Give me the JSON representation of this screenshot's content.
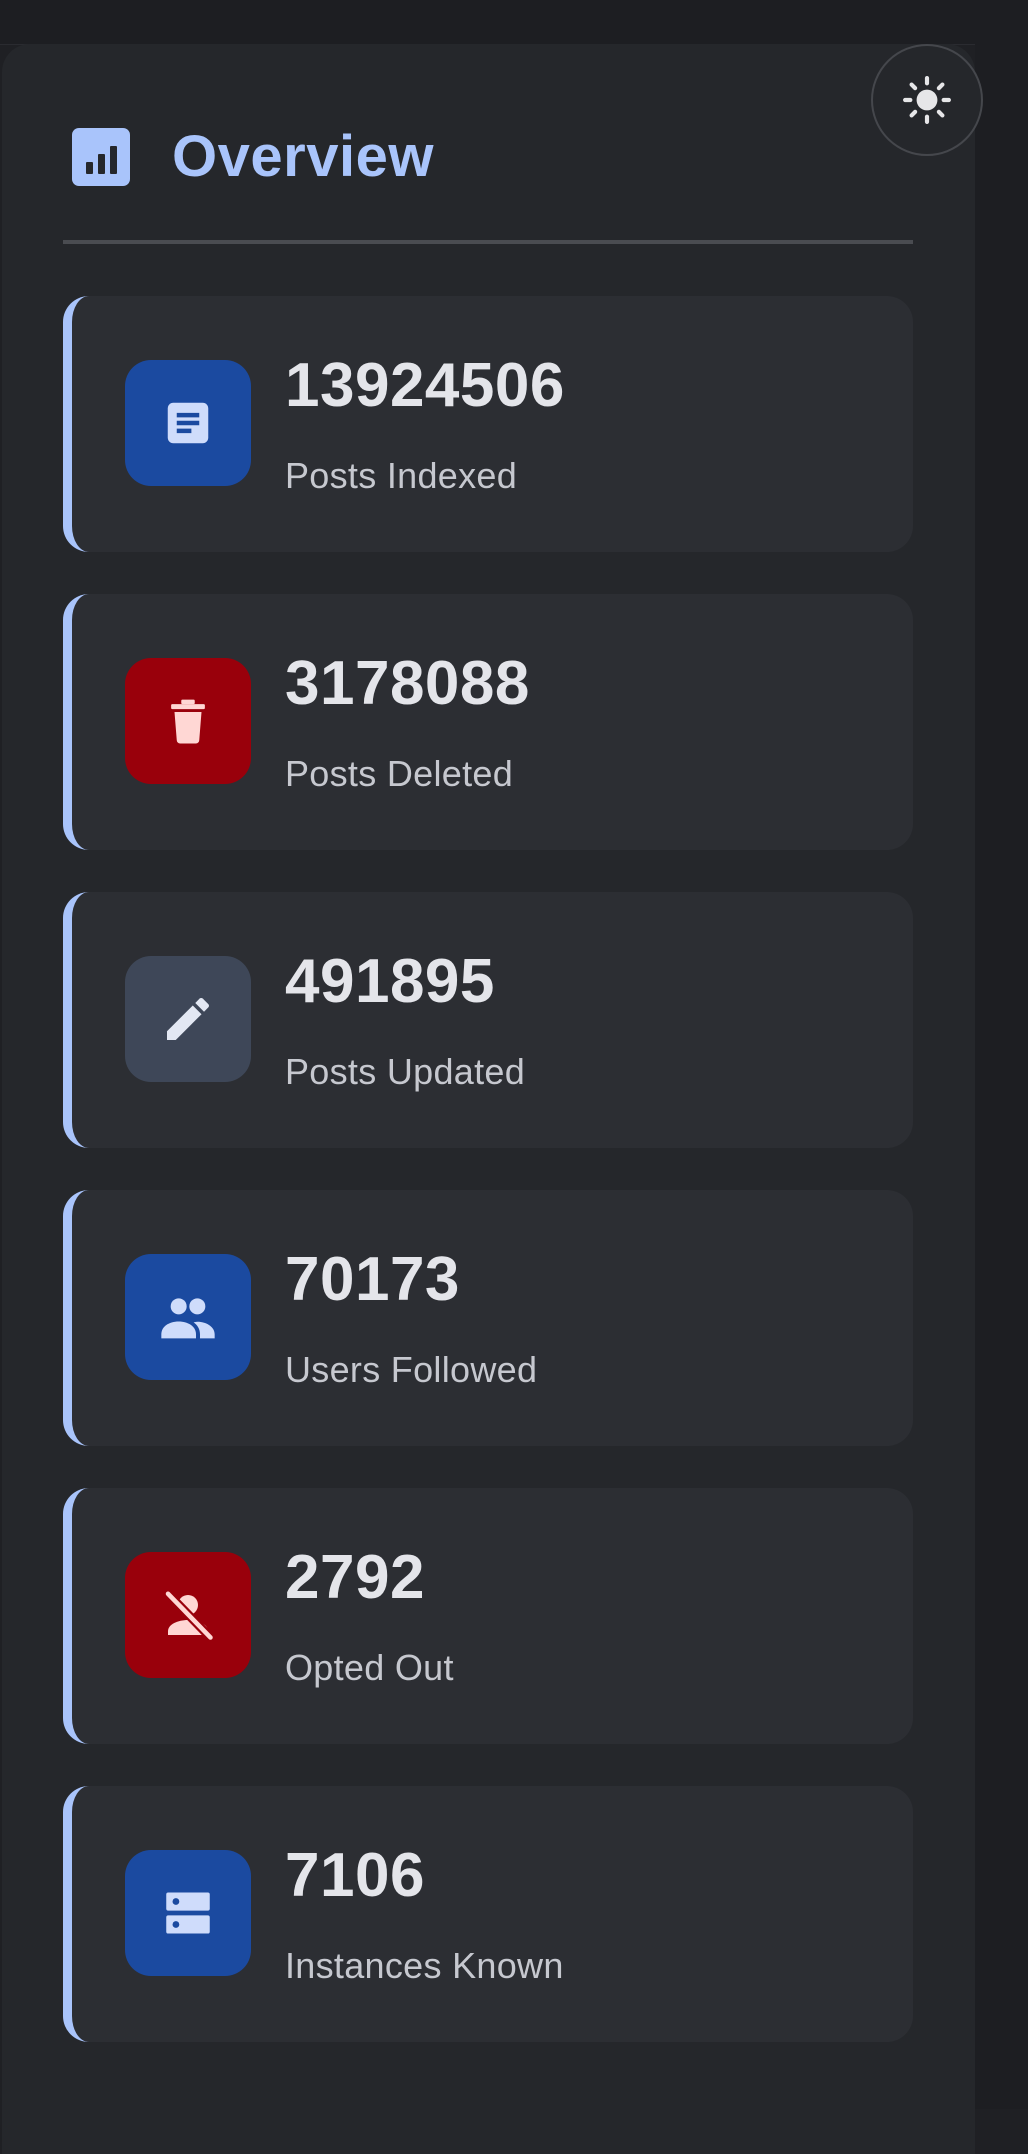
{
  "header": {
    "title": "Overview",
    "icon": "bar-chart-icon"
  },
  "theme_toggle": {
    "icon": "sun-icon"
  },
  "colors": {
    "accent": "#a9c4fb",
    "blue_tile": "#1b4aa0",
    "red_tile": "#99000b",
    "gray_tile": "#3e4758",
    "card_bg": "#2c2e33",
    "panel_bg": "#25272b"
  },
  "stats": [
    {
      "value": "13924506",
      "label": "Posts Indexed",
      "icon": "article-icon",
      "tile": "blue"
    },
    {
      "value": "3178088",
      "label": "Posts Deleted",
      "icon": "trash-icon",
      "tile": "red"
    },
    {
      "value": "491895",
      "label": "Posts Updated",
      "icon": "pencil-icon",
      "tile": "gray"
    },
    {
      "value": "70173",
      "label": "Users Followed",
      "icon": "people-icon",
      "tile": "blue"
    },
    {
      "value": "2792",
      "label": "Opted Out",
      "icon": "person-off-icon",
      "tile": "red"
    },
    {
      "value": "7106",
      "label": "Instances Known",
      "icon": "server-icon",
      "tile": "blue"
    }
  ]
}
